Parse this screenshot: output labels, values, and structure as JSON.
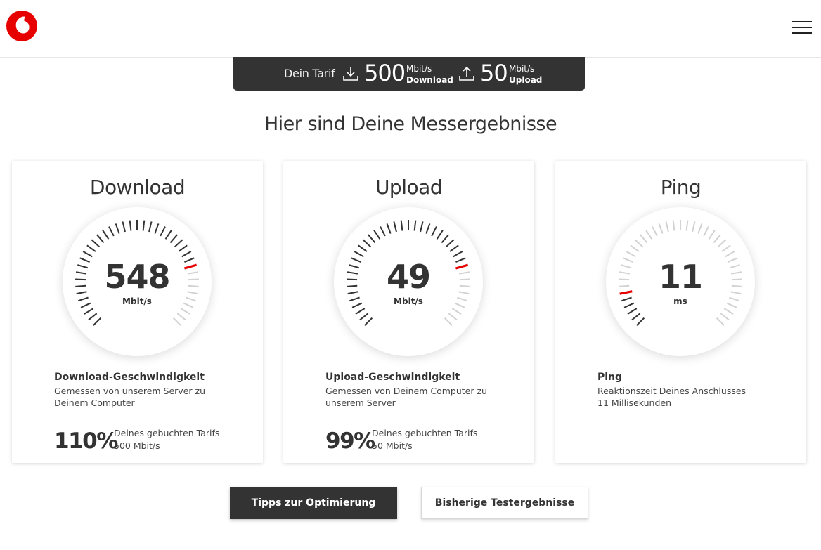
{
  "header": {
    "logo_icon": "vodafone-logo",
    "menu_icon": "hamburger-menu-icon",
    "brand_color": "#e60000"
  },
  "tariff": {
    "label": "Dein Tarif",
    "download_value": "500",
    "download_unit": "Mbit/s",
    "download_label": "Download",
    "upload_value": "50",
    "upload_unit": "Mbit/s",
    "upload_label": "Upload"
  },
  "page_title": "Hier sind Deine Messergebnisse",
  "cards": [
    {
      "title": "Download",
      "value": "548",
      "unit": "Mbit/s",
      "gauge_fill_fraction": 0.78,
      "desc_title": "Download-Geschwindigkeit",
      "desc_line1": "Gemessen von unserem Server zu",
      "desc_line2": "Deinem Computer",
      "percent": "110%",
      "percent_line1": "Deines gebuchten Tarifs",
      "percent_line2": "500 Mbit/s"
    },
    {
      "title": "Upload",
      "value": "49",
      "unit": "Mbit/s",
      "gauge_fill_fraction": 0.78,
      "desc_title": "Upload-Geschwindigkeit",
      "desc_line1": "Gemessen von Deinem Computer zu",
      "desc_line2": "unserem Server",
      "percent": "99%",
      "percent_line1": "Deines gebuchten Tarifs",
      "percent_line2": "50 Mbit/s"
    },
    {
      "title": "Ping",
      "value": "11",
      "unit": "ms",
      "gauge_fill_fraction": 0.12,
      "desc_title": "Ping",
      "desc_line1": "Reaktionszeit Deines Anschlusses",
      "desc_line2": "11 Millisekunden"
    }
  ],
  "buttons": {
    "tips": "Tipps zur Optimierung",
    "history": "Bisherige Testergebnisse"
  },
  "colors": {
    "dark": "#333333",
    "accent": "#e60000",
    "tick_inactive": "#d2d2d2"
  }
}
